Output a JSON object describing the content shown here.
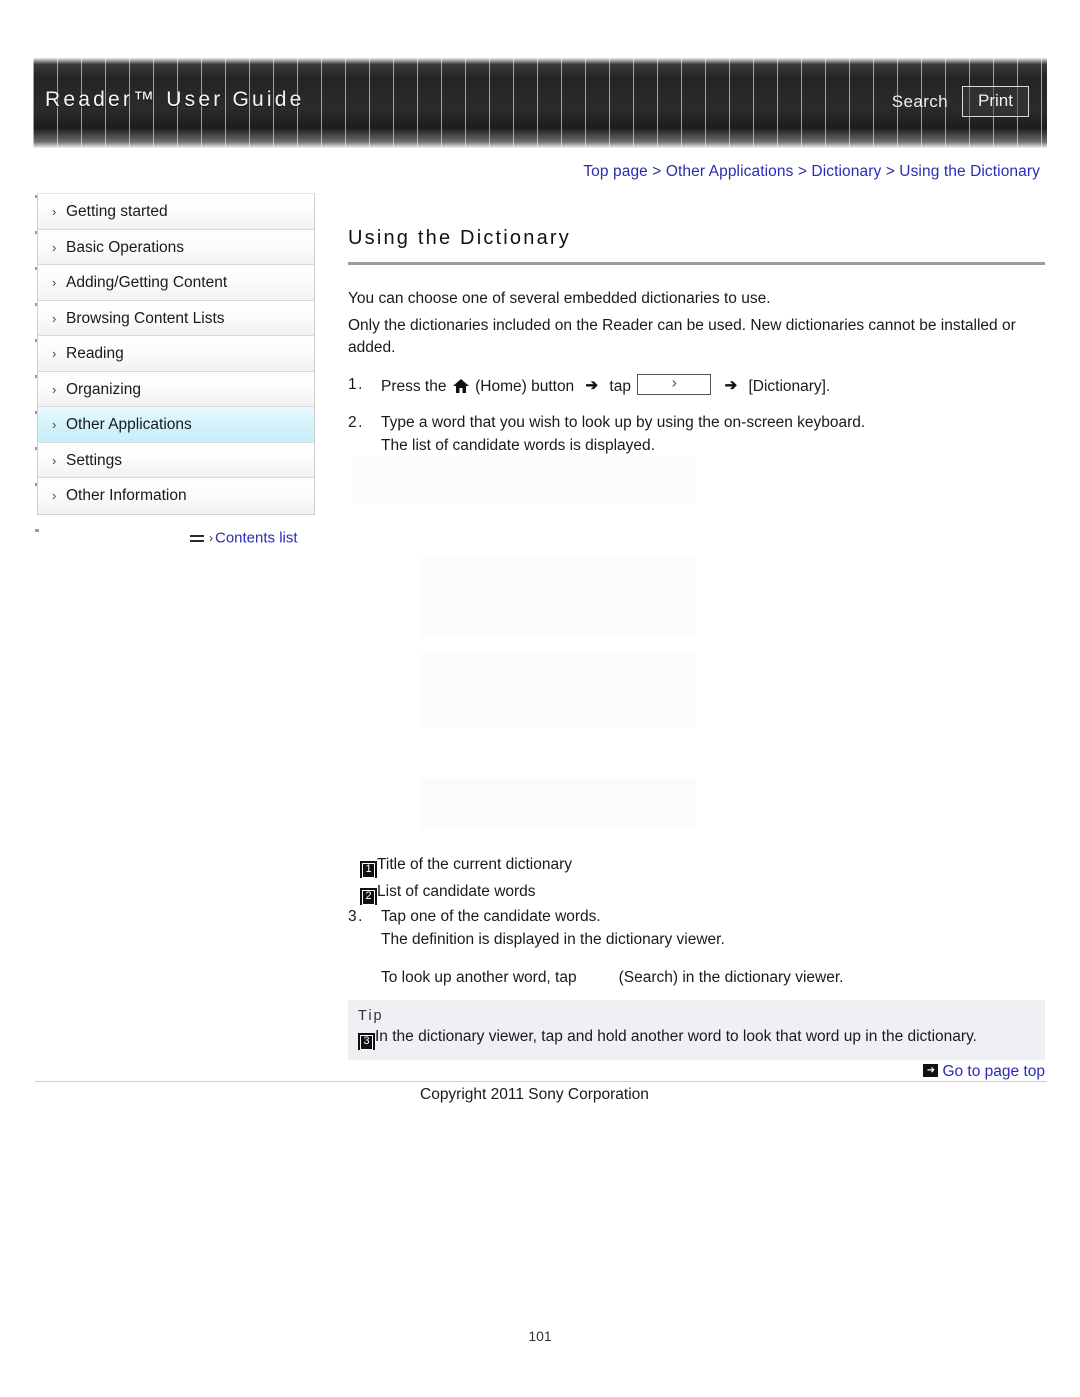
{
  "header": {
    "title": "Reader™ User Guide",
    "search_label": "Search",
    "print_label": "Print"
  },
  "breadcrumb": {
    "items": [
      "Top page",
      "Other Applications",
      "Dictionary",
      "Using the Dictionary"
    ],
    "separator": ">",
    "full_text": "Top page > Other Applications > Dictionary > Using the Dictionary"
  },
  "sidebar": {
    "bullet": "›",
    "items": [
      {
        "label": "Getting started",
        "active": false
      },
      {
        "label": "Basic Operations",
        "active": false
      },
      {
        "label": "Adding/Getting Content",
        "active": false
      },
      {
        "label": "Browsing Content Lists",
        "active": false
      },
      {
        "label": "Reading",
        "active": false
      },
      {
        "label": "Organizing",
        "active": false
      },
      {
        "label": "Other Applications",
        "active": true
      },
      {
        "label": "Settings",
        "active": false
      },
      {
        "label": "Other Information",
        "active": false
      }
    ],
    "contents_list_label": "Contents list"
  },
  "main": {
    "title": "Using the Dictionary",
    "intro": [
      "You can choose one of several embedded dictionaries to use.",
      "Only the dictionaries included on the Reader can be used. New dictionaries cannot be installed or added."
    ],
    "step1": {
      "number": "1.",
      "text_a": "Press the",
      "text_b": "(Home) button",
      "text_c": "tap",
      "text_d": "[Dictionary].",
      "home_icon_name": "home-icon",
      "arrow_glyph": "➔"
    },
    "step2": {
      "number": "2.",
      "line1": "Type a word that you wish to look up by using the on-screen keyboard.",
      "line2": "The list of candidate words is displayed."
    },
    "callouts": [
      {
        "badge": "1",
        "label": "Title of the current dictionary"
      },
      {
        "badge": "2",
        "label": "List of candidate words"
      }
    ],
    "step3": {
      "number": "3.",
      "line1": "Tap one of the candidate words.",
      "line2": "The definition is displayed in the dictionary viewer.",
      "line3_a": "To look up another word, tap",
      "line3_b": "(Search) in the dictionary viewer."
    },
    "tip": {
      "label": "Tip",
      "badge": "3",
      "text": "In the dictionary viewer, tap and hold another word to look that word up in the dictionary."
    }
  },
  "footer": {
    "goto_top_label": "Go to page top",
    "copyright": "Copyright 2011 Sony Corporation",
    "page_number": "101"
  },
  "colors": {
    "link": "#2b2bb5",
    "active_nav": "#d4f3fb",
    "tip_bg": "#eef0f3",
    "header_dark": "#242424"
  }
}
